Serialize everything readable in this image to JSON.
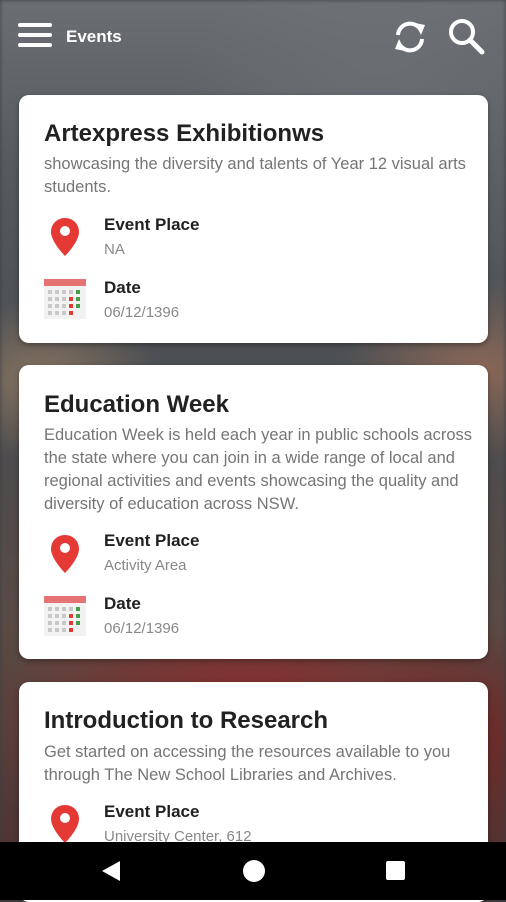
{
  "app": {
    "title": "Events"
  },
  "icons": {
    "menu": "menu-icon",
    "refresh": "refresh-icon",
    "search": "search-icon",
    "place": "location-pin-icon",
    "date": "calendar-icon"
  },
  "colors": {
    "pin": "#e53935",
    "calendar_header": "#e57373",
    "calendar_dot_accent": "#43a047"
  },
  "labels": {
    "place": "Event Place",
    "date": "Date"
  },
  "events": [
    {
      "title": "Artexpress Exhibitionws",
      "description": "showcasing the diversity and talents of Year 12 visual arts students.",
      "place": "NA",
      "date": "06/12/1396"
    },
    {
      "title": "Education Week",
      "description": "Education Week is held each year in public schools across the state where you can join in a wide range of local and regional activities and events showcasing the quality and diversity of education across NSW.",
      "place": "Activity Area",
      "date": "06/12/1396"
    },
    {
      "title": "Introduction to Research",
      "description": "Get started on accessing the resources available to you through The New School Libraries and Archives.",
      "place": "University Center, 612",
      "date": ""
    }
  ]
}
